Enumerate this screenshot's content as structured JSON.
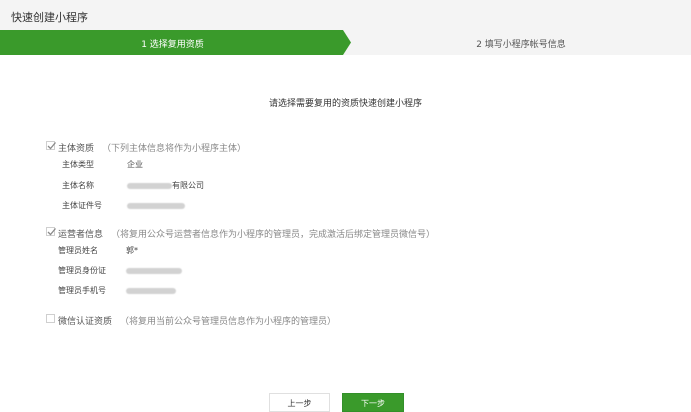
{
  "window": {
    "title": "快速创建小程序"
  },
  "steps": [
    {
      "label": "1 选择复用资质",
      "active": true
    },
    {
      "label": "2 填写小程序帐号信息",
      "active": false
    }
  ],
  "intro": "请选择需要复用的资质快速创建小程序",
  "sections": {
    "entity": {
      "title": "主体资质",
      "note": "（下列主体信息将作为小程序主体）",
      "checked": true,
      "rows": [
        {
          "label": "主体类型",
          "value": "企业"
        },
        {
          "label": "主体名称",
          "value": "有限公司"
        },
        {
          "label": "主体证件号",
          "value": ""
        }
      ]
    },
    "operator": {
      "title": "运营者信息",
      "note": "（将复用公众号运营者信息作为小程序的管理员，完成激活后绑定管理员微信号）",
      "checked": true,
      "rows": [
        {
          "label": "管理员姓名",
          "value": "郭*"
        },
        {
          "label": "管理员身份证",
          "value": ""
        },
        {
          "label": "管理员手机号",
          "value": ""
        }
      ]
    },
    "wechat_auth": {
      "title": "微信认证资质",
      "note": "（将复用当前公众号管理员信息作为小程序的管理员）",
      "checked": false
    }
  },
  "buttons": {
    "prev": "上一步",
    "next": "下一步"
  },
  "colors": {
    "accent": "#3a9a2b",
    "title_bar": "#f4f4f4"
  }
}
